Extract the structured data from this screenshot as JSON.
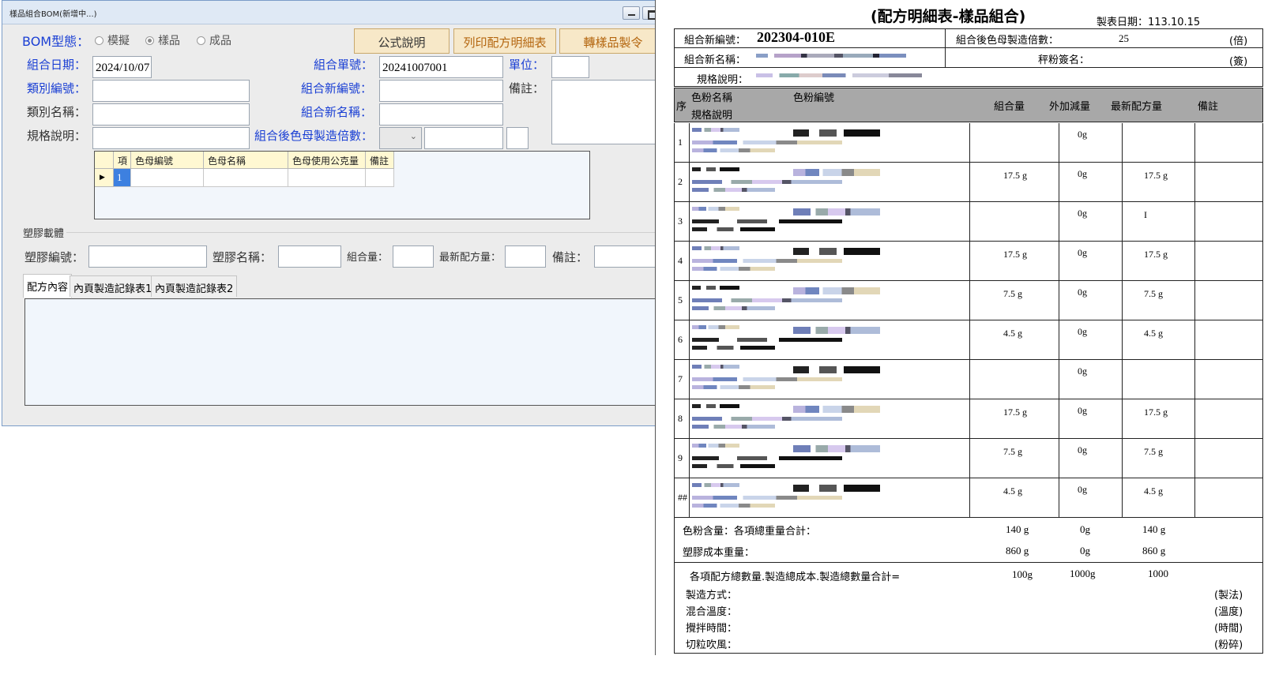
{
  "window": {
    "title": "樣品組合BOM(新增中...)"
  },
  "form": {
    "bom_type_label": "BOM型態：",
    "radio_options": [
      "模擬",
      "樣品",
      "成品"
    ],
    "selected_option": "樣品",
    "buttons": {
      "formula": "公式說明",
      "print": "列印配方明細表",
      "convert": "轉樣品製令"
    },
    "date_label": "組合日期：",
    "date_value": "2024/10/07",
    "order_no_label": "組合單號：",
    "order_no_value": "20241007001",
    "unit_label": "單位：",
    "category_no_label": "類別編號：",
    "category_name_label": "類別名稱：",
    "spec_label": "規格說明：",
    "new_code_label": "組合新編號：",
    "new_name_label": "組合新名稱：",
    "multiplier_label": "組合後色母製造倍數：",
    "remark_label": "備註：",
    "grid_headers": [
      "項",
      "色母編號",
      "色母名稱",
      "色母使用公克量",
      "備註"
    ],
    "grid_row_index": "1",
    "plastic_group_label": "塑膠載體",
    "plastic_code_label": "塑膠編號：",
    "plastic_name_label": "塑膠名稱：",
    "combo_qty_label": "組合量：",
    "latest_qty_label": "最新配方量：",
    "plastic_remark_label": "備註：",
    "tabs": [
      "配方內容",
      "內頁製造記錄表1",
      "內頁製造記錄表2"
    ]
  },
  "report": {
    "title": "(配方明細表-樣品組合)",
    "date": "製表日期：113.10.15",
    "new_code_label": "組合新編號：",
    "new_code_value": "202304-010E",
    "multiplier_label": "組合後色母製造倍數：",
    "multiplier_value": "25",
    "multiplier_unit": "(倍)",
    "new_name_label": "組合新名稱：",
    "weigher_label": "秤粉簽名：",
    "weigher_unit": "(簽)",
    "spec_label": "規格說明：",
    "headers": {
      "seq": "序",
      "powder_name": "色粉名稱",
      "spec": "規格說明",
      "powder_code": "色粉編號",
      "combo_qty": "組合量",
      "extra": "外加減量",
      "latest": "最新配方量",
      "remark": "備註"
    },
    "rows": [
      {
        "seq": "1",
        "combo": "",
        "extra": "0g",
        "latest": ""
      },
      {
        "seq": "2",
        "combo": "17.5 g",
        "extra": "0g",
        "latest": "17.5 g"
      },
      {
        "seq": "3",
        "combo": "",
        "extra": "0g",
        "latest": "I"
      },
      {
        "seq": "4",
        "combo": "17.5 g",
        "extra": "0g",
        "latest": "17.5 g"
      },
      {
        "seq": "5",
        "combo": "7.5 g",
        "extra": "0g",
        "latest": "7.5 g"
      },
      {
        "seq": "6",
        "combo": "4.5 g",
        "extra": "0g",
        "latest": "4.5 g"
      },
      {
        "seq": "7",
        "combo": "",
        "extra": "0g",
        "latest": ""
      },
      {
        "seq": "8",
        "combo": "17.5 g",
        "extra": "0g",
        "latest": "17.5 g"
      },
      {
        "seq": "9",
        "combo": "7.5 g",
        "extra": "0g",
        "latest": "7.5 g"
      },
      {
        "seq": "##",
        "combo": "4.5 g",
        "extra": "0g",
        "latest": "4.5 g"
      }
    ],
    "powder_total_label": "色粉含量：各項總重量合計：",
    "powder_total": [
      "140 g",
      "0g",
      "140 g"
    ],
    "plastic_cost_label": "塑膠成本重量：",
    "plastic_cost": [
      "860 g",
      "0g",
      "860 g"
    ],
    "grand_label": "各項配方總數量.製造總成本.製造總數量合計=",
    "grand": [
      "100g",
      "1000g",
      "1000"
    ],
    "footer": [
      {
        "label": "製造方式：",
        "unit": "(製法)"
      },
      {
        "label": "混合溫度：",
        "unit": "(溫度)"
      },
      {
        "label": "攪拌時間：",
        "unit": "(時間)"
      },
      {
        "label": "切粒吹風：",
        "unit": "(粉碎)"
      }
    ]
  }
}
